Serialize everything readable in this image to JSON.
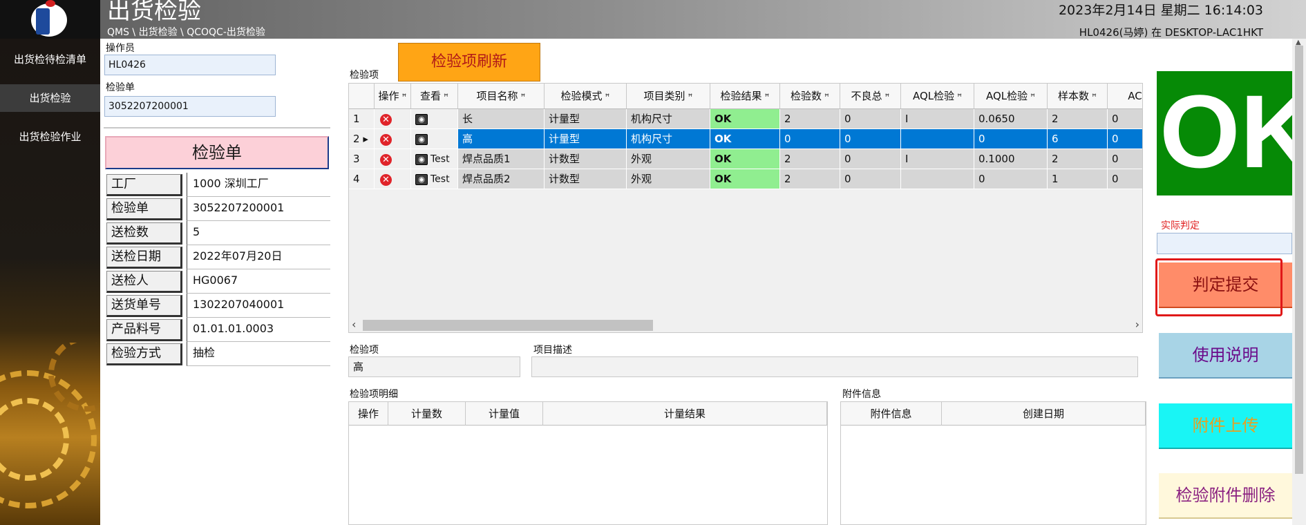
{
  "header": {
    "title": "出货检验",
    "breadcrumb": "QMS \\ 出货检验 \\ QCOQC-出货检验",
    "datetime": "2023年2月14日 星期二 16:14:03",
    "user": "HL0426(马婷) 在 DESKTOP-LAC1HKT"
  },
  "sidebar": {
    "items": [
      {
        "label": "出货检待检清单"
      },
      {
        "label": "出货检验"
      },
      {
        "label": "出货检验作业"
      }
    ]
  },
  "form": {
    "operator_label": "操作员",
    "operator_value": "HL0426",
    "order_label": "检验单",
    "order_value": "3052207200001"
  },
  "order_panel": {
    "title": "检验单",
    "rows": [
      {
        "key": "工厂",
        "value": "1000 深圳工厂"
      },
      {
        "key": "检验单",
        "value": "3052207200001"
      },
      {
        "key": "送检数",
        "value": "5"
      },
      {
        "key": "送检日期",
        "value": "2022年07月20日"
      },
      {
        "key": "送检人",
        "value": "HG0067"
      },
      {
        "key": "送货单号",
        "value": "1302207040001"
      },
      {
        "key": "产品料号",
        "value": "01.01.01.0003"
      },
      {
        "key": "检验方式",
        "value": "抽检"
      }
    ]
  },
  "refresh_button": "检验项刷新",
  "grid": {
    "label": "检验项",
    "columns": [
      "操作",
      "查看",
      "项目名称",
      "检验模式",
      "项目类别",
      "检验结果",
      "检验数",
      "不良总",
      "AQL检验",
      "AQL检验",
      "样本数",
      "AC"
    ],
    "rows": [
      {
        "no": "1",
        "view": "",
        "name": "长",
        "mode": "计量型",
        "category": "机构尺寸",
        "result": "OK",
        "count": "2",
        "bad": "0",
        "aql1": "I",
        "aql2": "0.0650",
        "sample": "2",
        "ac": "0",
        "selected": false
      },
      {
        "no": "2",
        "view": "",
        "name": "高",
        "mode": "计量型",
        "category": "机构尺寸",
        "result": "OK",
        "count": "0",
        "bad": "0",
        "aql1": "",
        "aql2": "0",
        "sample": "6",
        "ac": "0",
        "selected": true
      },
      {
        "no": "3",
        "view": "Test",
        "name": "焊点品质1",
        "mode": "计数型",
        "category": "外观",
        "result": "OK",
        "count": "2",
        "bad": "0",
        "aql1": "I",
        "aql2": "0.1000",
        "sample": "2",
        "ac": "0",
        "selected": false
      },
      {
        "no": "4",
        "view": "Test",
        "name": "焊点品质2",
        "mode": "计数型",
        "category": "外观",
        "result": "OK",
        "count": "2",
        "bad": "0",
        "aql1": "",
        "aql2": "0",
        "sample": "1",
        "ac": "0",
        "selected": false
      }
    ]
  },
  "detail": {
    "item_label": "检验项",
    "item_value": "高",
    "desc_label": "项目描述",
    "desc_value": ""
  },
  "item_detail": {
    "label": "检验项明细",
    "columns": [
      "操作",
      "计量数",
      "计量值",
      "计量结果"
    ]
  },
  "attachments": {
    "label": "附件信息",
    "columns": [
      "附件信息",
      "创建日期"
    ]
  },
  "right_panel": {
    "status": "OK",
    "status_color": "#068a06",
    "actual_label": "实际判定",
    "actual_value": "",
    "submit_button": "判定提交",
    "help_button": "使用说明",
    "upload_button": "附件上传",
    "delete_button": "检验附件删除"
  }
}
